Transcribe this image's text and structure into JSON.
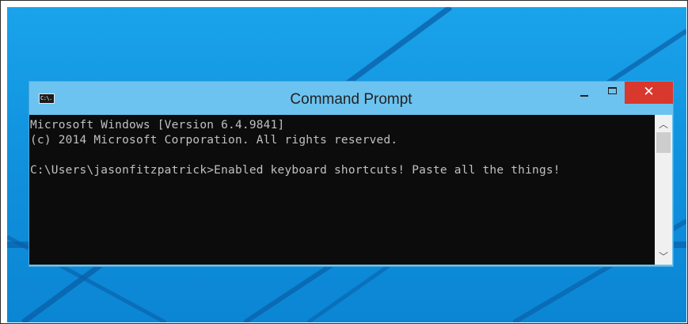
{
  "window": {
    "title": "Command Prompt",
    "icon_label": "C:\\.",
    "close_glyph": "✕",
    "scroll_up_glyph": "︿",
    "scroll_down_glyph": "﹀"
  },
  "console": {
    "lines": [
      "Microsoft Windows [Version 6.4.9841]",
      "(c) 2014 Microsoft Corporation. All rights reserved.",
      "",
      "C:\\Users\\jasonfitzpatrick>Enabled keyboard shortcuts! Paste all the things!"
    ]
  },
  "colors": {
    "titlebar": "#6cc3f0",
    "close_button": "#d9382d",
    "console_bg": "#0c0c0c",
    "console_text": "#c0c0c0",
    "desktop": "#1aa3ea"
  },
  "icons": [
    "cmd-icon",
    "minimize-icon",
    "maximize-icon",
    "close-icon",
    "scroll-up-arrow-icon",
    "scroll-down-arrow-icon"
  ]
}
